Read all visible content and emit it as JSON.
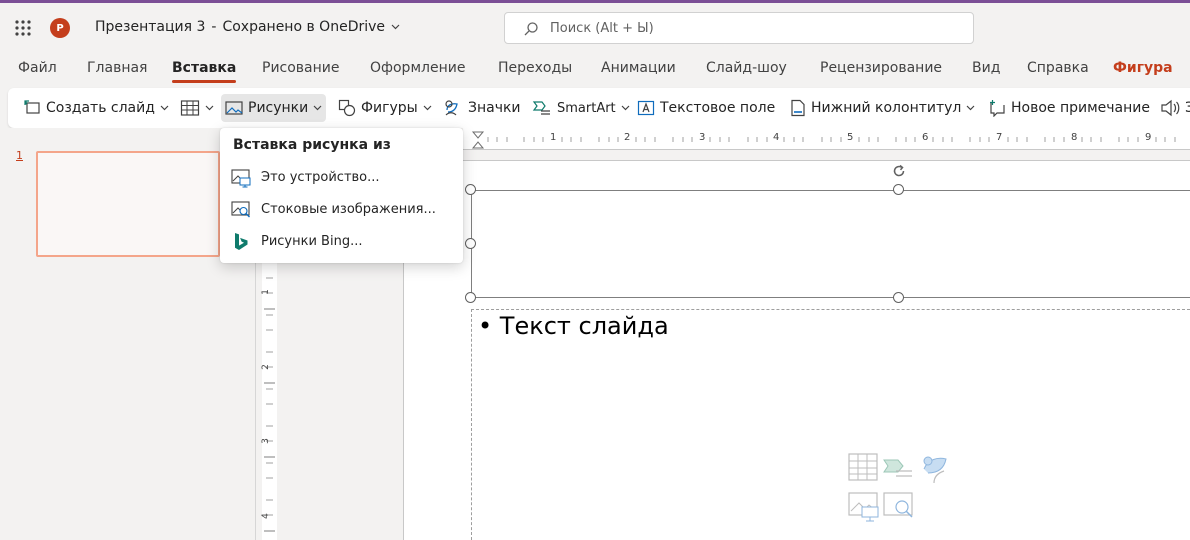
{
  "app": {
    "doc_title": "Презентация 3",
    "separator": "-",
    "save_status": "Сохранено в OneDrive"
  },
  "search": {
    "placeholder": "Поиск (Alt + Ы)"
  },
  "tabs": [
    {
      "label": "Файл"
    },
    {
      "label": "Главная"
    },
    {
      "label": "Вставка"
    },
    {
      "label": "Рисование"
    },
    {
      "label": "Оформление"
    },
    {
      "label": "Переходы"
    },
    {
      "label": "Анимации"
    },
    {
      "label": "Слайд-шоу"
    },
    {
      "label": "Рецензирование"
    },
    {
      "label": "Вид"
    },
    {
      "label": "Справка"
    },
    {
      "label": "Фигура"
    }
  ],
  "toolbar": {
    "new_slide": "Создать слайд",
    "pictures": "Рисунки",
    "shapes": "Фигуры",
    "icons": "Значки",
    "smartart": "SmartArt",
    "textbox": "Текстовое поле",
    "footer": "Нижний колонтитул",
    "new_comment": "Новое примечание",
    "audio_partial": "З"
  },
  "dropdown": {
    "header": "Вставка рисунка из",
    "items": [
      {
        "label": "Это устройство...",
        "icon": "device-picture-icon"
      },
      {
        "label": "Стоковые изображения...",
        "icon": "stock-images-icon"
      },
      {
        "label": "Рисунки Bing...",
        "icon": "bing-icon"
      }
    ]
  },
  "slides_panel": {
    "slide_number": "1"
  },
  "ruler": {
    "h_numbers": [
      "1",
      "2",
      "3",
      "4",
      "5",
      "6",
      "7",
      "8",
      "9"
    ],
    "v_numbers": [
      "1",
      "2",
      "3",
      "4"
    ]
  },
  "slide": {
    "body_text": "• Текст слайда"
  },
  "colors": {
    "accent": "#c43e1c",
    "title_accent_bar": "#7b4f96"
  }
}
